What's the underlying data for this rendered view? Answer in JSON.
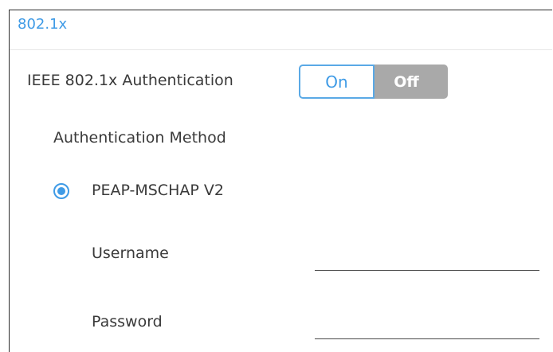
{
  "section": {
    "title": "802.1x"
  },
  "auth_toggle": {
    "label": "IEEE 802.1x Authentication",
    "on_label": "On",
    "off_label": "Off",
    "selected": "On"
  },
  "method": {
    "heading": "Authentication Method",
    "options": [
      {
        "label": "PEAP-MSCHAP V2",
        "selected": true
      }
    ]
  },
  "credentials": {
    "username_label": "Username",
    "username_value": "",
    "password_label": "Password",
    "password_value": ""
  },
  "colors": {
    "accent": "#3f9be6",
    "toggle_off_bg": "#a9a9a9",
    "text": "#3a3a3a"
  }
}
